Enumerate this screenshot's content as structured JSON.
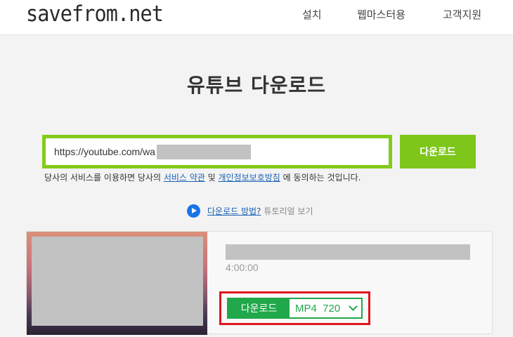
{
  "header": {
    "logo": "savefrom.net",
    "nav": [
      "설치",
      "웹마스터용",
      "고객지원"
    ]
  },
  "page": {
    "title": "유튜브 다운로드"
  },
  "search": {
    "value": "https://youtube.com/wa",
    "button_label": "다운로드"
  },
  "terms": {
    "prefix": "당사의 서비스를 이용하면 당사의 ",
    "service_link": "서비스 약관",
    "and": " 및 ",
    "privacy_link": "개인정보보호방침",
    "suffix": " 에 동의하는 것입니다."
  },
  "howto": {
    "link": "다운로드 방법?",
    "text": "튜토리얼 보기"
  },
  "result": {
    "duration": "4:00:00",
    "download_label": "다운로드",
    "format": "MP4  720"
  },
  "colors": {
    "accent_green": "#7ec61a",
    "download_green": "#20a84a",
    "highlight_red": "#e0141e",
    "link_blue": "#1a62b5"
  }
}
